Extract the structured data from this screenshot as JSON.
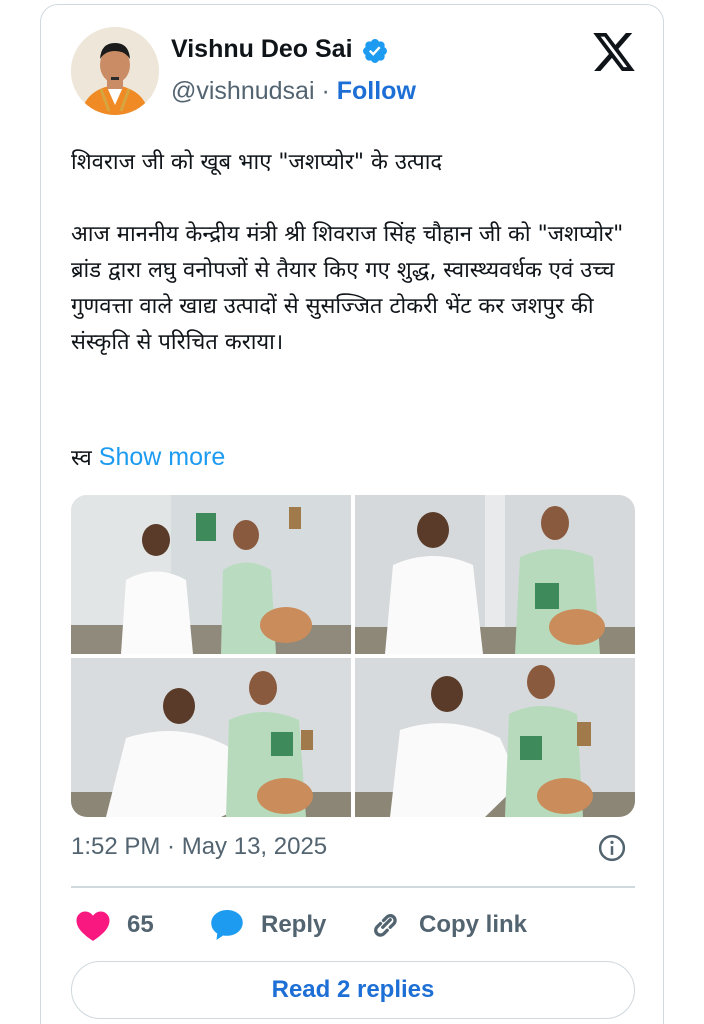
{
  "author": {
    "name": "Vishnu Deo Sai",
    "handle": "@vishnudsai",
    "separator": " · ",
    "follow_label": "Follow",
    "verified_color": "#1d9bf0"
  },
  "tweet": {
    "line1": "शिवराज जी को खूब भाए \"जशप्योर\" के उत्पाद",
    "paragraph2": "आज माननीय केन्द्रीय मंत्री श्री शिवराज सिंह चौहान जी को \"जशप्योर\" ब्रांड द्वारा लघु वनोपजों से तैयार किए गए शुद्ध, स्वास्थ्यवर्धक एवं उच्च गुणवत्ता वाले खाद्य उत्पादों से सुसज्जित टोकरी भेंट कर जशपुर की संस्कृति से परिचित कराया।",
    "truncated_prefix": "स्व",
    "show_more_label": "Show more"
  },
  "timestamp": "1:52 PM · May 13, 2025",
  "actions": {
    "like_count": "65",
    "reply_label": "Reply",
    "copy_link_label": "Copy link"
  },
  "read_replies_label": "Read 2 replies",
  "colors": {
    "like": "#f91880",
    "reply": "#1d9bf0",
    "link": "#1d6fd6",
    "muted": "#536471",
    "border": "#cfd9de"
  }
}
